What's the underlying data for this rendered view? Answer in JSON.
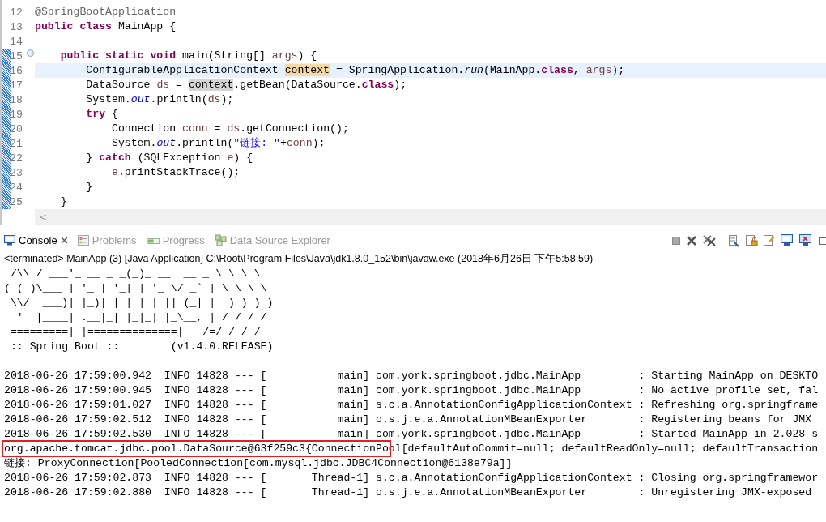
{
  "editor": {
    "lines": [
      {
        "number": "12",
        "current": false,
        "changed": false,
        "fold_marker": false,
        "segments": [
          {
            "text": "@SpringBootApplication",
            "kind": "annotation"
          }
        ]
      },
      {
        "number": "13",
        "current": false,
        "changed": false,
        "fold_marker": false,
        "segments": [
          {
            "text": "public class",
            "kind": "keyword"
          },
          {
            "text": " MainApp {",
            "kind": "plain"
          }
        ]
      },
      {
        "number": "14",
        "current": false,
        "changed": false,
        "fold_marker": false
      },
      {
        "number": "15",
        "current": false,
        "changed": true,
        "fold_marker": true,
        "segments": [
          {
            "text": "    public static void",
            "kind": "keyword"
          },
          {
            "text": " main(String[] ",
            "kind": "plain"
          },
          {
            "text": "args",
            "kind": "local"
          },
          {
            "text": ") {",
            "kind": "plain"
          }
        ]
      },
      {
        "number": "16",
        "current": true,
        "changed": true,
        "fold_marker": false,
        "segments": [
          {
            "text": "        ConfigurableApplicationContext ",
            "kind": "plain"
          },
          {
            "text": "context",
            "kind": "write_occurrence"
          },
          {
            "text": " = SpringApplication.",
            "kind": "plain"
          },
          {
            "text": "run",
            "kind": "static_method"
          },
          {
            "text": "(MainApp.",
            "kind": "plain"
          },
          {
            "text": "class",
            "kind": "keyword"
          },
          {
            "text": ", ",
            "kind": "plain"
          },
          {
            "text": "args",
            "kind": "local"
          },
          {
            "text": ");",
            "kind": "plain"
          }
        ]
      },
      {
        "number": "17",
        "current": false,
        "changed": true,
        "fold_marker": false,
        "segments": [
          {
            "text": "        DataSource ",
            "kind": "plain"
          },
          {
            "text": "ds",
            "kind": "local"
          },
          {
            "text": " = ",
            "kind": "plain"
          },
          {
            "text": "context",
            "kind": "read_occurrence"
          },
          {
            "text": ".getBean(DataSource.",
            "kind": "plain"
          },
          {
            "text": "class",
            "kind": "keyword"
          },
          {
            "text": ");",
            "kind": "plain"
          }
        ]
      },
      {
        "number": "18",
        "current": false,
        "changed": true,
        "fold_marker": false,
        "segments": [
          {
            "text": "        System.",
            "kind": "plain"
          },
          {
            "text": "out",
            "kind": "field"
          },
          {
            "text": ".println(",
            "kind": "plain"
          },
          {
            "text": "ds",
            "kind": "local"
          },
          {
            "text": ");",
            "kind": "plain"
          }
        ]
      },
      {
        "number": "19",
        "current": false,
        "changed": true,
        "fold_marker": false,
        "segments": [
          {
            "text": "        try",
            "kind": "keyword"
          },
          {
            "text": " {",
            "kind": "plain"
          }
        ]
      },
      {
        "number": "20",
        "current": false,
        "changed": true,
        "fold_marker": false,
        "segments": [
          {
            "text": "            Connection ",
            "kind": "plain"
          },
          {
            "text": "conn",
            "kind": "local"
          },
          {
            "text": " = ",
            "kind": "plain"
          },
          {
            "text": "ds",
            "kind": "local"
          },
          {
            "text": ".getConnection();",
            "kind": "plain"
          }
        ]
      },
      {
        "number": "21",
        "current": false,
        "changed": true,
        "fold_marker": false,
        "segments": [
          {
            "text": "            System.",
            "kind": "plain"
          },
          {
            "text": "out",
            "kind": "field"
          },
          {
            "text": ".println(",
            "kind": "plain"
          },
          {
            "text": "\"链接: \"",
            "kind": "string"
          },
          {
            "text": "+",
            "kind": "plain"
          },
          {
            "text": "conn",
            "kind": "local"
          },
          {
            "text": ");",
            "kind": "plain"
          }
        ]
      },
      {
        "number": "22",
        "current": false,
        "changed": true,
        "fold_marker": false,
        "segments": [
          {
            "text": "        } ",
            "kind": "plain"
          },
          {
            "text": "catch",
            "kind": "keyword"
          },
          {
            "text": " (SQLException ",
            "kind": "plain"
          },
          {
            "text": "e",
            "kind": "local"
          },
          {
            "text": ") {",
            "kind": "plain"
          }
        ]
      },
      {
        "number": "23",
        "current": false,
        "changed": true,
        "fold_marker": false,
        "segments": [
          {
            "text": "            e",
            "kind": "local"
          },
          {
            "text": ".printStackTrace();",
            "kind": "plain"
          }
        ]
      },
      {
        "number": "24",
        "current": false,
        "changed": true,
        "fold_marker": false,
        "segments": [
          {
            "text": "        }",
            "kind": "plain"
          }
        ]
      },
      {
        "number": "25",
        "current": false,
        "changed": true,
        "fold_marker": false,
        "segments": [
          {
            "text": "    }",
            "kind": "plain"
          }
        ]
      }
    ],
    "scroll_arrow": "<"
  },
  "view_tabs": [
    {
      "label": "Console",
      "selected": true,
      "closable": true,
      "kind": "console"
    },
    {
      "label": "Problems",
      "selected": false,
      "closable": false,
      "kind": "problems"
    },
    {
      "label": "Progress",
      "selected": false,
      "closable": false,
      "kind": "progress"
    },
    {
      "label": "Data Source Explorer",
      "selected": false,
      "closable": false,
      "kind": "datasource"
    }
  ],
  "console": {
    "status": "<terminated> MainApp (3) [Java Application] C:\\Root\\Program Files\\Java\\jdk1.8.0_152\\bin\\javaw.exe (2018年6月26日 下午5:58:59)",
    "banner": [
      " /\\\\ / ___'_ __ _ _(_)_ __  __ _ \\ \\ \\ \\",
      "( ( )\\___ | '_ | '_| | '_ \\/ _` | \\ \\ \\ \\",
      " \\\\/  ___)| |_)| | | | | || (_| |  ) ) ) )",
      "  '  |____| .__|_| |_|_| |_\\__, | / / / /",
      " =========|_|==============|___/=/_/_/_/",
      " :: Spring Boot ::        (v1.4.0.RELEASE)"
    ],
    "log_lines": [
      {
        "segments": [
          {
            "text": "2018-06-26 17:59:00.942  INFO 14828 --- [           main] com.york.springboot.jdbc.MainApp         : Starting MainApp on DESKTO",
            "boxed": false
          }
        ]
      },
      {
        "segments": [
          {
            "text": "2018-06-26 17:59:00.945  INFO 14828 --- [           main] com.york.springboot.jdbc.MainApp         : No active profile set, fal",
            "boxed": false
          }
        ]
      },
      {
        "segments": [
          {
            "text": "2018-06-26 17:59:01.027  INFO 14828 --- [           main] s.c.a.AnnotationConfigApplicationContext : Refreshing org.springframe",
            "boxed": false
          }
        ]
      },
      {
        "segments": [
          {
            "text": "2018-06-26 17:59:02.512  INFO 14828 --- [           main] o.s.j.e.a.AnnotationMBeanExporter        : Registering beans for JMX",
            "boxed": false
          }
        ]
      },
      {
        "segments": [
          {
            "text": "2018-06-26 17:59:02.530  INFO 14828 --- [           main] com.york.springboot.jdbc.MainApp         : Started MainApp in 2.028 s",
            "boxed": false
          }
        ]
      },
      {
        "segments": [
          {
            "text": "org.apache.tomcat.jdbc.pool.DataSource@63f259c3{ConnectionPo",
            "boxed": true
          },
          {
            "text": "ol[defaultAutoCommit=null; defaultReadOnly=null; defaultTransaction",
            "boxed": false
          }
        ]
      },
      {
        "segments": [
          {
            "text": "链接: ProxyConnection[PooledConnection[com.mysql.jdbc.JDBC4Connection@6138e79a]]",
            "boxed": false
          }
        ]
      },
      {
        "segments": [
          {
            "text": "2018-06-26 17:59:02.873  INFO 14828 --- [       Thread-1] s.c.a.AnnotationConfigApplicationContext : Closing org.springframewor",
            "boxed": false
          }
        ]
      },
      {
        "segments": [
          {
            "text": "2018-06-26 17:59:02.880  INFO 14828 --- [       Thread-1] o.s.j.e.a.AnnotationMBeanExporter        : Unregistering JMX-exposed",
            "boxed": false
          }
        ]
      }
    ]
  }
}
